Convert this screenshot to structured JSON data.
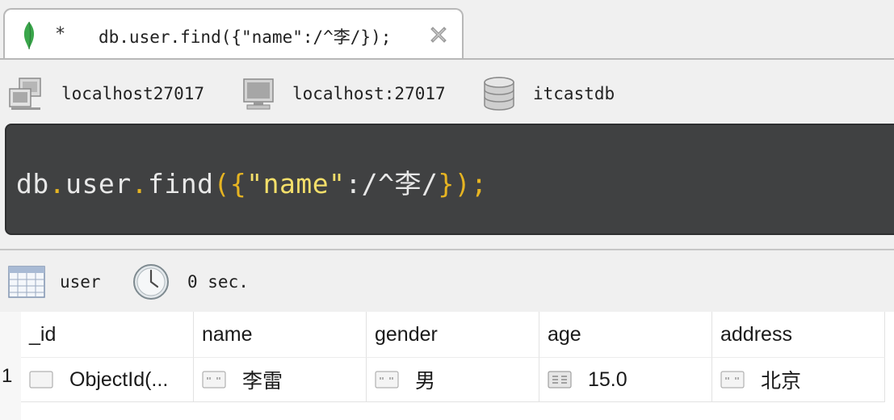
{
  "tab": {
    "dirty_marker": "*",
    "title": "db.user.find({\"name\":/^李/});"
  },
  "connection": {
    "server_name": "localhost27017",
    "host": "localhost:27017",
    "database": "itcastdb"
  },
  "editor": {
    "tokens": [
      {
        "text": "db",
        "color": "#e8e8e8"
      },
      {
        "text": ".",
        "color": "#e6b422"
      },
      {
        "text": "user",
        "color": "#e8e8e8"
      },
      {
        "text": ".",
        "color": "#e6b422"
      },
      {
        "text": "find",
        "color": "#e8e8e8"
      },
      {
        "text": "({",
        "color": "#e6b422"
      },
      {
        "text": "\"name\"",
        "color": "#f4df6a"
      },
      {
        "text": ":/^李/",
        "color": "#e8e8e8"
      },
      {
        "text": "});",
        "color": "#e6b422"
      }
    ]
  },
  "result": {
    "collection": "user",
    "duration": "0 sec."
  },
  "grid": {
    "columns": [
      "_id",
      "name",
      "gender",
      "age",
      "address"
    ],
    "rows": [
      {
        "num": "1",
        "cells": [
          "ObjectId(...",
          "李雷",
          "男",
          "15.0",
          "北京"
        ]
      }
    ]
  },
  "colors": {
    "editor_bg": "#404142",
    "mongo_leaf": "#3aa64b"
  }
}
